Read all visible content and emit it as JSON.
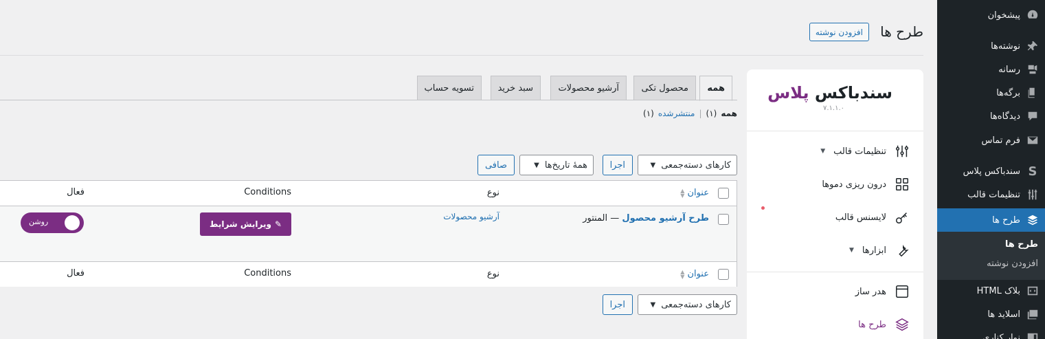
{
  "admin_menu": {
    "items": [
      {
        "label": "پیشخوان",
        "icon": "dashboard-icon"
      },
      {
        "label": "نوشته‌ها",
        "icon": "pin-icon"
      },
      {
        "label": "رسانه",
        "icon": "media-icon"
      },
      {
        "label": "برگه‌ها",
        "icon": "pages-icon"
      },
      {
        "label": "دیدگاه‌ها",
        "icon": "comments-icon"
      },
      {
        "label": "فرم تماس",
        "icon": "mail-icon"
      },
      {
        "label": "سندباکس پلاس",
        "icon": "sandbox-s-icon"
      },
      {
        "label": "تنظیمات قالب",
        "icon": "sliders-icon"
      },
      {
        "label": "طرح ها",
        "icon": "layers-icon"
      },
      {
        "label": "بلاک HTML",
        "icon": "html-icon"
      },
      {
        "label": "اسلاید ها",
        "icon": "slides-icon"
      },
      {
        "label": "نوار کناری",
        "icon": "sidebar-icon"
      }
    ],
    "submenu": {
      "current": "طرح ها",
      "add_new": "افزودن نوشته"
    }
  },
  "header": {
    "title": "طرح ها",
    "add_new_button": "افزودن نوشته"
  },
  "panel": {
    "logo_part1": "سندباکس",
    "logo_part2": "پلاس",
    "version": "۷.۱.۱.۰",
    "items": [
      {
        "label": "تنظیمات قالب",
        "icon": "sliders-icon"
      },
      {
        "label": "درون ریزی دموها",
        "icon": "grid-icon"
      },
      {
        "label": "لایسنس قالب",
        "icon": "key-icon"
      },
      {
        "label": "ابزارها",
        "icon": "wrench-icon"
      },
      {
        "label": "هدر ساز",
        "icon": "window-icon"
      },
      {
        "label": "طرح ها",
        "icon": "layers-icon"
      }
    ]
  },
  "tabs": [
    "همه",
    "محصول تکی",
    "آرشیو محصولات",
    "سبد خرید",
    "تسویه حساب"
  ],
  "filters": {
    "all": "همه",
    "all_count": "(۱)",
    "separator": "|",
    "published": "منتشرشده",
    "published_count": "(۱)"
  },
  "bulk": {
    "actions": "کارهای دسته‌جمعی",
    "apply": "اجرا",
    "dates": "همهٔ تاریخ‌ها",
    "filter": "صافی"
  },
  "table": {
    "columns": {
      "title": "عنوان",
      "type": "نوع",
      "conditions": "Conditions",
      "active": "فعال"
    },
    "rows": [
      {
        "title": "طرح آرشیو محصول",
        "title_suffix": "— المنتور",
        "type": "آرشیو محصولات",
        "edit_button": "ویرایش شرایط",
        "toggle_label": "روشن"
      }
    ]
  },
  "colors": {
    "admin_bg": "#1d2327",
    "accent": "#2271b1",
    "brand": "#7b2d83",
    "page_bg": "#f0f0f1"
  }
}
